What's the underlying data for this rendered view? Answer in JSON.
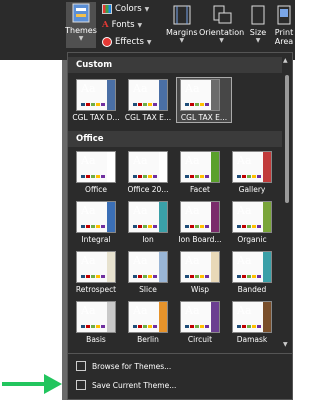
{
  "ribbon": {
    "themes_label": "Themes",
    "colors_label": "Colors",
    "fonts_label": "Fonts",
    "effects_label": "Effects",
    "margins_label": "Margins",
    "orientation_label": "Orientation",
    "size_label": "Size",
    "print_line1": "Print",
    "print_line2": "Area"
  },
  "panel": {
    "custom_header": "Custom",
    "office_header": "Office",
    "custom_themes": [
      "CGL TAX D...",
      "CGL TAX E...",
      "CGL TAX E..."
    ],
    "office_themes": [
      "Office",
      "Office 20...",
      "Facet",
      "Gallery",
      "Integral",
      "Ion",
      "Ion Board...",
      "Organic",
      "Retrospect",
      "Slice",
      "Wisp",
      "Banded",
      "Basis",
      "Berlin",
      "Circuit",
      "Damask"
    ],
    "browse_label": "Browse for Themes...",
    "save_label": "Save Current Theme..."
  },
  "colors": {
    "arrow": "#22c55e",
    "panel_bg": "#2b2b2b",
    "header_bg": "#3b3b3b"
  }
}
